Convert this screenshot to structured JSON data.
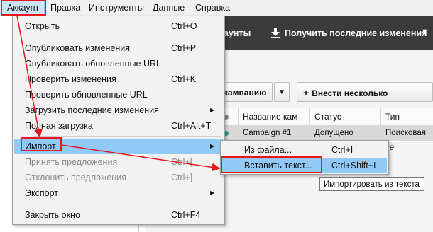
{
  "menubar": {
    "items": [
      {
        "label": "Аккаунт"
      },
      {
        "label": "Правка"
      },
      {
        "label": "Инструменты"
      },
      {
        "label": "Данные"
      },
      {
        "label": "Справка"
      }
    ]
  },
  "toolbar": {
    "accounts_partial": "аунты",
    "get_changes": "Получить последние изменения",
    "campaign_partial": "кампанию",
    "multi_changes": "Внести несколько изменений"
  },
  "grid": {
    "headers": [
      "Название кам",
      "Статус",
      "Тип кампани"
    ],
    "row": {
      "name": "Campaign #1",
      "status": "Допущено",
      "type": "Поисковая се"
    }
  },
  "menu": {
    "items": [
      {
        "label": "Открыть",
        "shortcut": "Ctrl+O"
      },
      {
        "label": "Опубликовать изменения",
        "shortcut": "Ctrl+P"
      },
      {
        "label": "Опубликовать обновленные URL",
        "shortcut": ""
      },
      {
        "label": "Проверить изменения",
        "shortcut": "Ctrl+K"
      },
      {
        "label": "Проверить обновленные URL",
        "shortcut": ""
      },
      {
        "label": "Загрузить последние изменения",
        "shortcut": ""
      },
      {
        "label": "Полная загрузка",
        "shortcut": "Ctrl+Alt+T"
      },
      {
        "label": "Импорт",
        "shortcut": ""
      },
      {
        "label": "Принять предложения",
        "shortcut": "Ctrl+["
      },
      {
        "label": "Отклонить предложения",
        "shortcut": "Ctrl+]"
      },
      {
        "label": "Экспорт",
        "shortcut": ""
      },
      {
        "label": "Закрыть окно",
        "shortcut": "Ctrl+F4"
      }
    ]
  },
  "submenu": {
    "items": [
      {
        "label": "Из файла...",
        "shortcut": "Ctrl+I"
      },
      {
        "label": "Вставить текст...",
        "shortcut": "Ctrl+Shift+I"
      }
    ]
  },
  "tooltip": "Импортировать из текста",
  "colors": {
    "highlight": "#91c9f7",
    "annotation": "#e8151b",
    "toolbar_dark": "#3b3b3b",
    "status_dot": "#1aa58a"
  }
}
